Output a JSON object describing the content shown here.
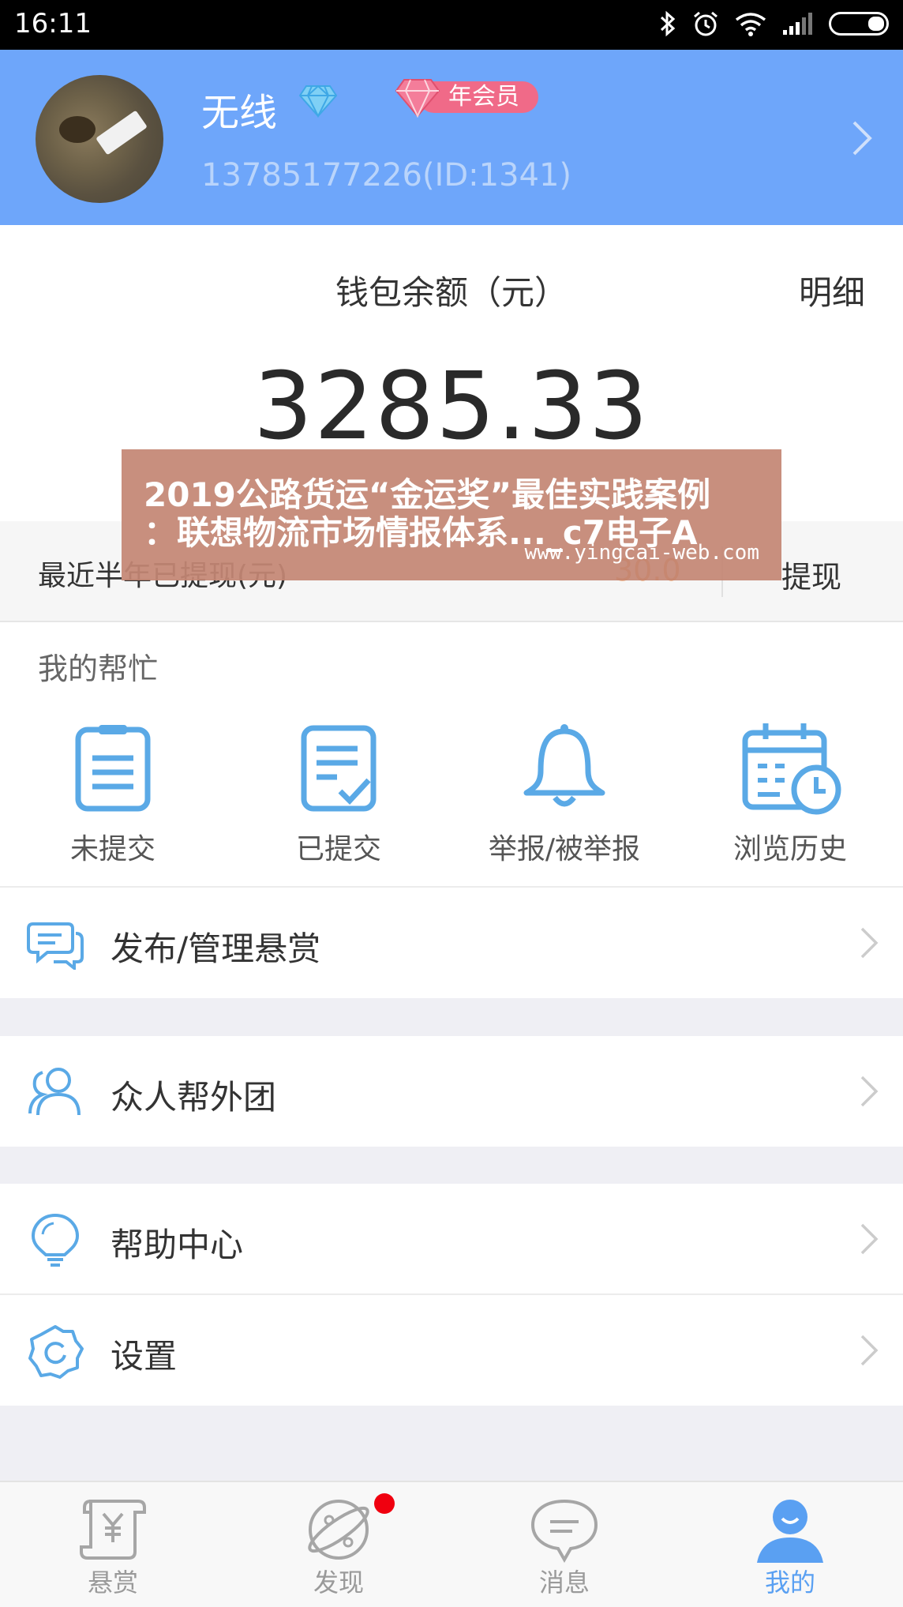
{
  "status_bar": {
    "time": "16:11"
  },
  "profile": {
    "nickname": "无线",
    "vip_label": "年会员",
    "phone_id": "13785177226(ID:1341)"
  },
  "wallet": {
    "title": "钱包余额（元）",
    "detail_label": "明细",
    "balance": "3285.33",
    "recent_withdraw_label": "最近半年已提现(元)",
    "recent_withdraw_amount": "30.0",
    "withdraw_button": "提现"
  },
  "overlay_banner": {
    "line1": "2019公路货运“金运奖”最佳实践案例",
    "line2": "：联想物流市场情报体系..._c7电子A",
    "url": "www.yingcai-web.com"
  },
  "help": {
    "title": "我的帮忙",
    "items": [
      {
        "label": "未提交",
        "icon": "clipboard-icon"
      },
      {
        "label": "已提交",
        "icon": "document-check-icon"
      },
      {
        "label": "举报/被举报",
        "icon": "bell-icon"
      },
      {
        "label": "浏览历史",
        "icon": "calendar-clock-icon"
      }
    ]
  },
  "menu": {
    "publish": "发布/管理悬赏",
    "group": "众人帮外团",
    "help_center": "帮助中心",
    "settings": "设置"
  },
  "tabs": [
    {
      "label": "悬赏",
      "icon": "scroll-yuan-icon"
    },
    {
      "label": "发现",
      "icon": "planet-icon"
    },
    {
      "label": "消息",
      "icon": "chat-bubble-icon"
    },
    {
      "label": "我的",
      "icon": "user-icon"
    }
  ],
  "colors": {
    "header_blue": "#6ea6fa",
    "accent_blue": "#5aa0f2",
    "icon_blue": "#5aa9e6",
    "orange": "#f08a3a",
    "badge_red": "#f0000f"
  }
}
